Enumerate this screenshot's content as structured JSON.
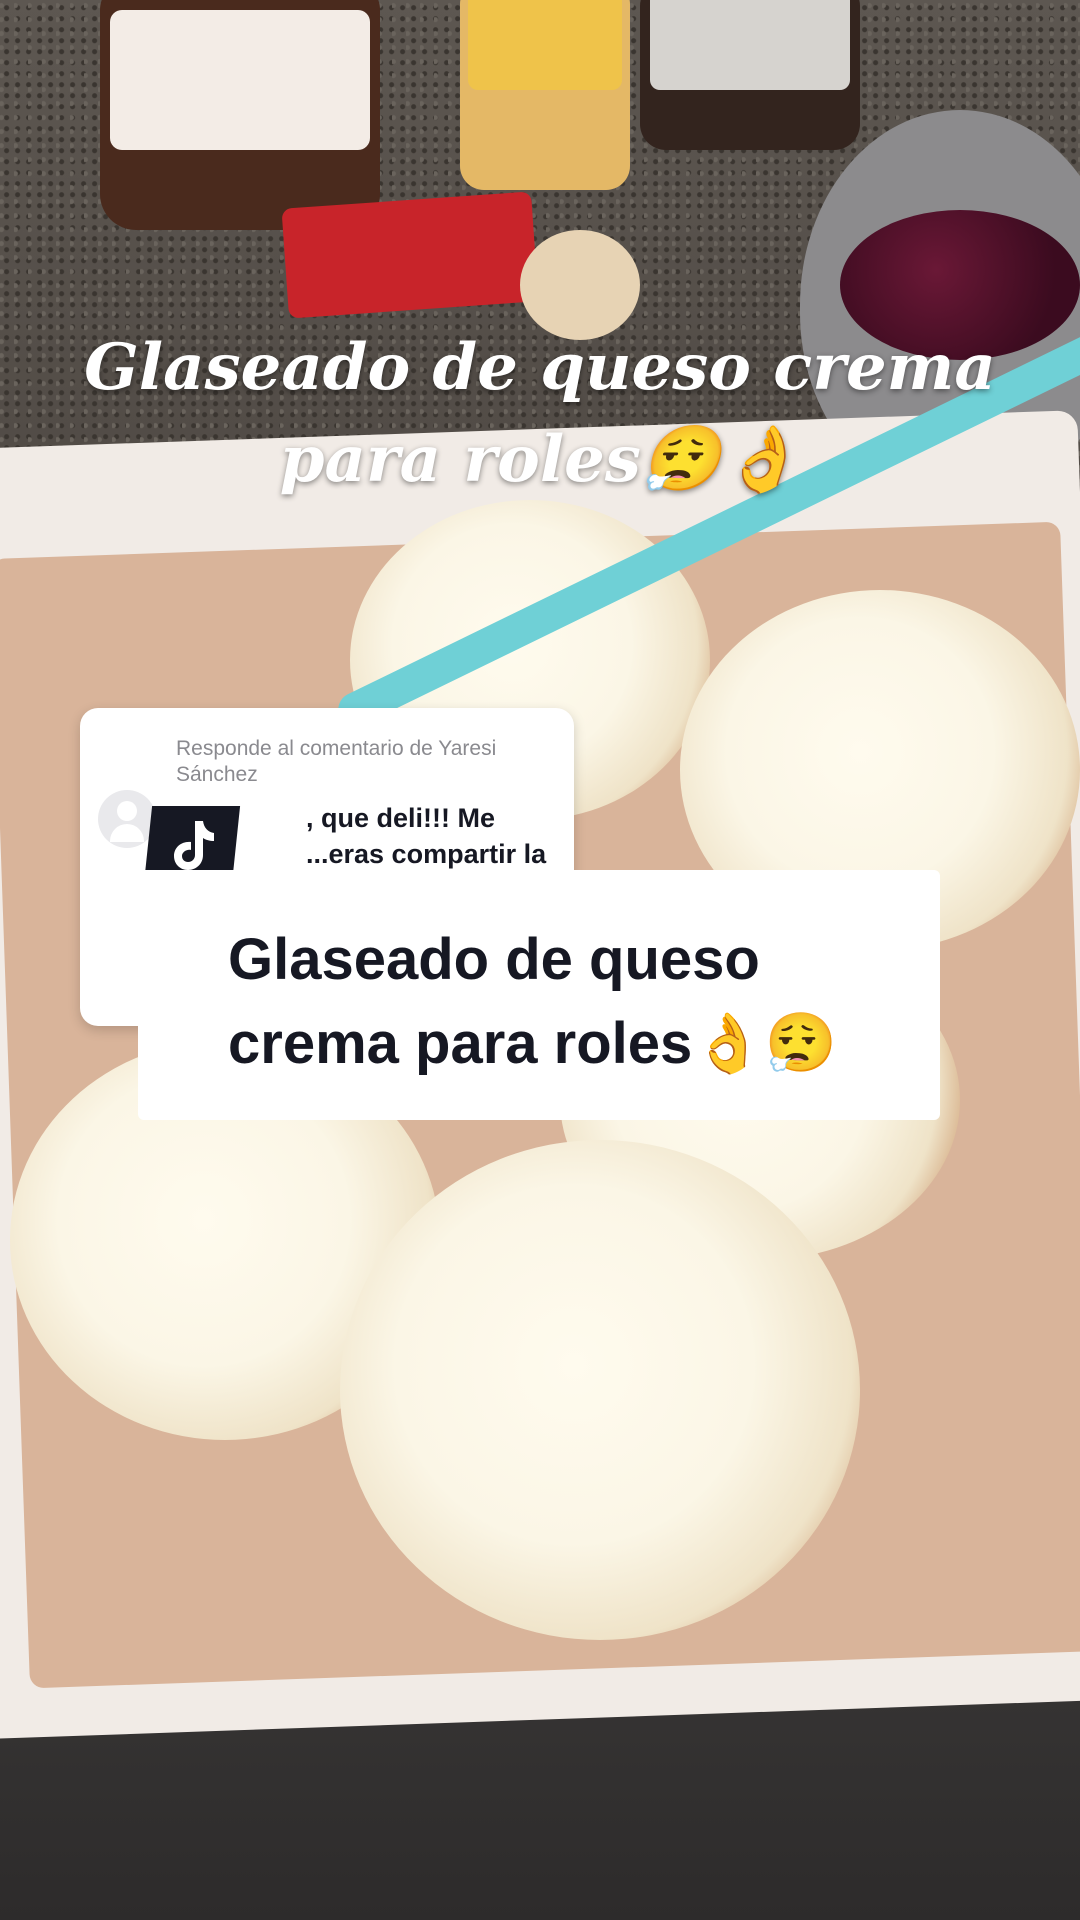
{
  "overlay": {
    "headline": "Glaseado de queso crema para roles😮‍💨👌"
  },
  "reply": {
    "header": "Responde al comentario de Yaresi Sánchez",
    "text": ", que deli!!! Me ...eras compartir la"
  },
  "caption": {
    "text": "Glaseado de queso crema para roles👌😮‍💨"
  },
  "icons": {
    "app_badge": "tiktok-logo-icon",
    "avatar": "default-avatar-icon"
  },
  "colors": {
    "caption_text": "#161823",
    "card_bg": "#ffffff",
    "reply_header": "#8a8a8f"
  }
}
